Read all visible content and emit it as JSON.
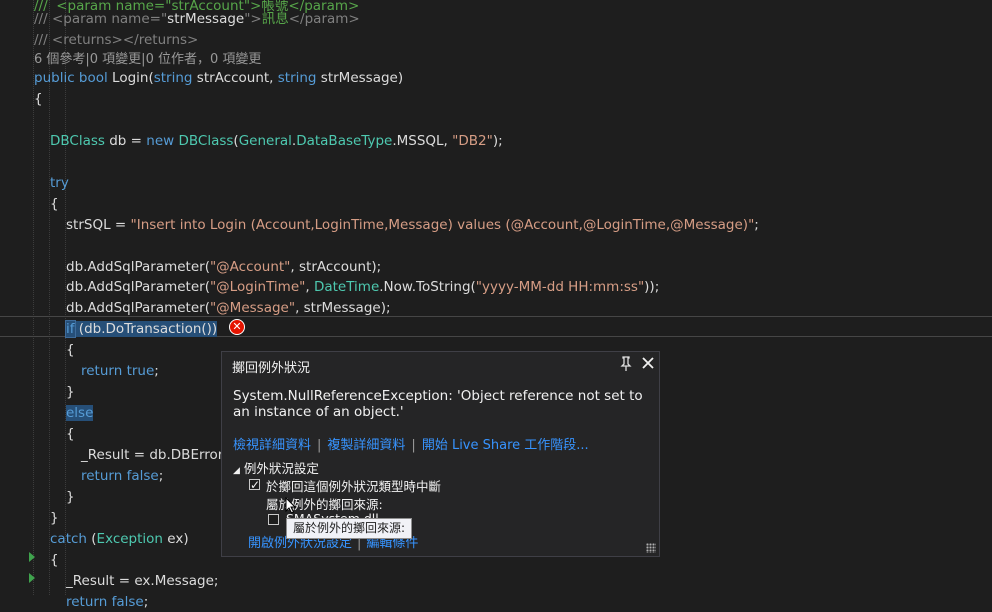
{
  "editor": {
    "lines": [
      {
        "id": "doc1",
        "parts": [
          {
            "c": "cm",
            "t": "///  <param name=\"strAccount\">帳號</param>"
          }
        ]
      },
      {
        "id": "doc2",
        "parts": [
          {
            "c": "cmg",
            "t": "/// "
          },
          {
            "c": "cmg",
            "t": "<param name=\""
          },
          {
            "c": "txt",
            "t": "strMessage"
          },
          {
            "c": "cmg",
            "t": "\">"
          },
          {
            "c": "cm",
            "t": "訊息"
          },
          {
            "c": "cmg",
            "t": "</param>"
          }
        ]
      },
      {
        "id": "doc3",
        "parts": [
          {
            "c": "cmg",
            "t": "/// <returns></returns>"
          }
        ]
      },
      {
        "id": "lens",
        "parts": [
          {
            "c": "lens",
            "t": "6 個參考|0 項變更|0 位作者，0 項變更"
          }
        ]
      },
      {
        "id": "sig",
        "parts": [
          {
            "c": "kw",
            "t": "public bool "
          },
          {
            "c": "txt",
            "t": "Login("
          },
          {
            "c": "kw",
            "t": "string "
          },
          {
            "c": "txt",
            "t": "strAccount, "
          },
          {
            "c": "kw",
            "t": "string "
          },
          {
            "c": "txt",
            "t": "strMessage)"
          }
        ]
      },
      {
        "id": "ob1",
        "parts": [
          {
            "c": "txt",
            "t": "{"
          }
        ]
      },
      {
        "id": "blank1",
        "parts": []
      },
      {
        "id": "db",
        "parts": [
          {
            "c": "ty",
            "t": "DBClass "
          },
          {
            "c": "txt",
            "t": "db = "
          },
          {
            "c": "kw",
            "t": "new "
          },
          {
            "c": "ty",
            "t": "DBClass"
          },
          {
            "c": "txt",
            "t": "("
          },
          {
            "c": "ty",
            "t": "General"
          },
          {
            "c": "txt",
            "t": "."
          },
          {
            "c": "ty",
            "t": "DataBaseType"
          },
          {
            "c": "txt",
            "t": ".MSSQL, "
          },
          {
            "c": "str",
            "t": "\"DB2\""
          },
          {
            "c": "txt",
            "t": ");"
          }
        ]
      },
      {
        "id": "blank2",
        "parts": []
      },
      {
        "id": "try",
        "parts": [
          {
            "c": "kw",
            "t": "try"
          }
        ]
      },
      {
        "id": "ob2",
        "parts": [
          {
            "c": "txt",
            "t": "{"
          }
        ]
      },
      {
        "id": "sql",
        "parts": [
          {
            "c": "txt",
            "t": "strSQL = "
          },
          {
            "c": "str",
            "t": "\"Insert into Login (Account,LoginTime,Message) values (@Account,@LoginTime,@Message)\""
          },
          {
            "c": "txt",
            "t": ";"
          }
        ]
      },
      {
        "id": "blank3",
        "parts": []
      },
      {
        "id": "p1",
        "parts": [
          {
            "c": "txt",
            "t": "db.AddSqlParameter("
          },
          {
            "c": "str",
            "t": "\"@Account\""
          },
          {
            "c": "txt",
            "t": ", strAccount);"
          }
        ]
      },
      {
        "id": "p2",
        "parts": [
          {
            "c": "txt",
            "t": "db.AddSqlParameter("
          },
          {
            "c": "str",
            "t": "\"@LoginTime\""
          },
          {
            "c": "txt",
            "t": ", "
          },
          {
            "c": "ty",
            "t": "DateTime"
          },
          {
            "c": "txt",
            "t": ".Now.ToString("
          },
          {
            "c": "str",
            "t": "\"yyyy-MM-dd HH:mm:ss\""
          },
          {
            "c": "txt",
            "t": "));"
          }
        ]
      },
      {
        "id": "p3",
        "parts": [
          {
            "c": "txt",
            "t": "db.AddSqlParameter("
          },
          {
            "c": "str",
            "t": "\"@Message\""
          },
          {
            "c": "txt",
            "t": ", strMessage);"
          }
        ]
      },
      {
        "id": "if",
        "parts": [
          {
            "c": "kw hl2",
            "t": "if"
          },
          {
            "c": "txt hl",
            "t": " (db.DoTransaction())"
          }
        ]
      },
      {
        "id": "ob3",
        "parts": [
          {
            "c": "txt",
            "t": "{"
          }
        ]
      },
      {
        "id": "rt",
        "parts": [
          {
            "c": "kw",
            "t": "return true"
          },
          {
            "c": "txt",
            "t": ";"
          }
        ]
      },
      {
        "id": "cb3",
        "parts": [
          {
            "c": "txt",
            "t": "}"
          }
        ]
      },
      {
        "id": "else",
        "parts": [
          {
            "c": "kw hl",
            "t": "else"
          }
        ]
      },
      {
        "id": "ob4",
        "parts": [
          {
            "c": "txt",
            "t": "{"
          }
        ]
      },
      {
        "id": "res",
        "parts": [
          {
            "c": "txt",
            "t": "_Result = db.DBErrorM"
          }
        ]
      },
      {
        "id": "rf",
        "parts": [
          {
            "c": "kw",
            "t": "return false"
          },
          {
            "c": "txt",
            "t": ";"
          }
        ]
      },
      {
        "id": "cb4",
        "parts": [
          {
            "c": "txt",
            "t": "}"
          }
        ]
      },
      {
        "id": "cb2",
        "parts": [
          {
            "c": "txt",
            "t": "}"
          }
        ]
      },
      {
        "id": "catch",
        "parts": [
          {
            "c": "kw",
            "t": "catch "
          },
          {
            "c": "txt",
            "t": "("
          },
          {
            "c": "ty",
            "t": "Exception "
          },
          {
            "c": "txt",
            "t": "ex)"
          }
        ]
      },
      {
        "id": "ob5",
        "parts": [
          {
            "c": "txt",
            "t": "{"
          }
        ]
      },
      {
        "id": "res2",
        "parts": [
          {
            "c": "txt",
            "t": "_Result = ex.Message;"
          }
        ]
      },
      {
        "id": "rf2",
        "parts": [
          {
            "c": "kw",
            "t": "return false"
          },
          {
            "c": "txt",
            "t": ";"
          }
        ]
      }
    ]
  },
  "popup": {
    "title": "擲回例外狀況",
    "exception_type": "System.NullReferenceException:",
    "exception_message": " 'Object reference not set to an instance of an object.'",
    "links": [
      "檢視詳細資料",
      "複製詳細資料",
      "開始 Live Share 工作階段..."
    ],
    "settings_header": "例外狀況設定",
    "option1_label": "於擲回這個例外狀況類型時中斷",
    "option1_checked": true,
    "option2_label": "屬於例外的擲回來源:",
    "option3_label": "SMASystem.dll",
    "bottom_links": [
      "開啟例外狀況設定",
      "編輯條件"
    ]
  },
  "tooltip": {
    "text": "屬於例外的擲回來源:"
  },
  "colors": {
    "error": "#e51400",
    "link": "#3794ff",
    "keyword": "#569cd6",
    "type": "#4ec9b0",
    "string": "#d69d85",
    "comment": "#57a64a"
  }
}
